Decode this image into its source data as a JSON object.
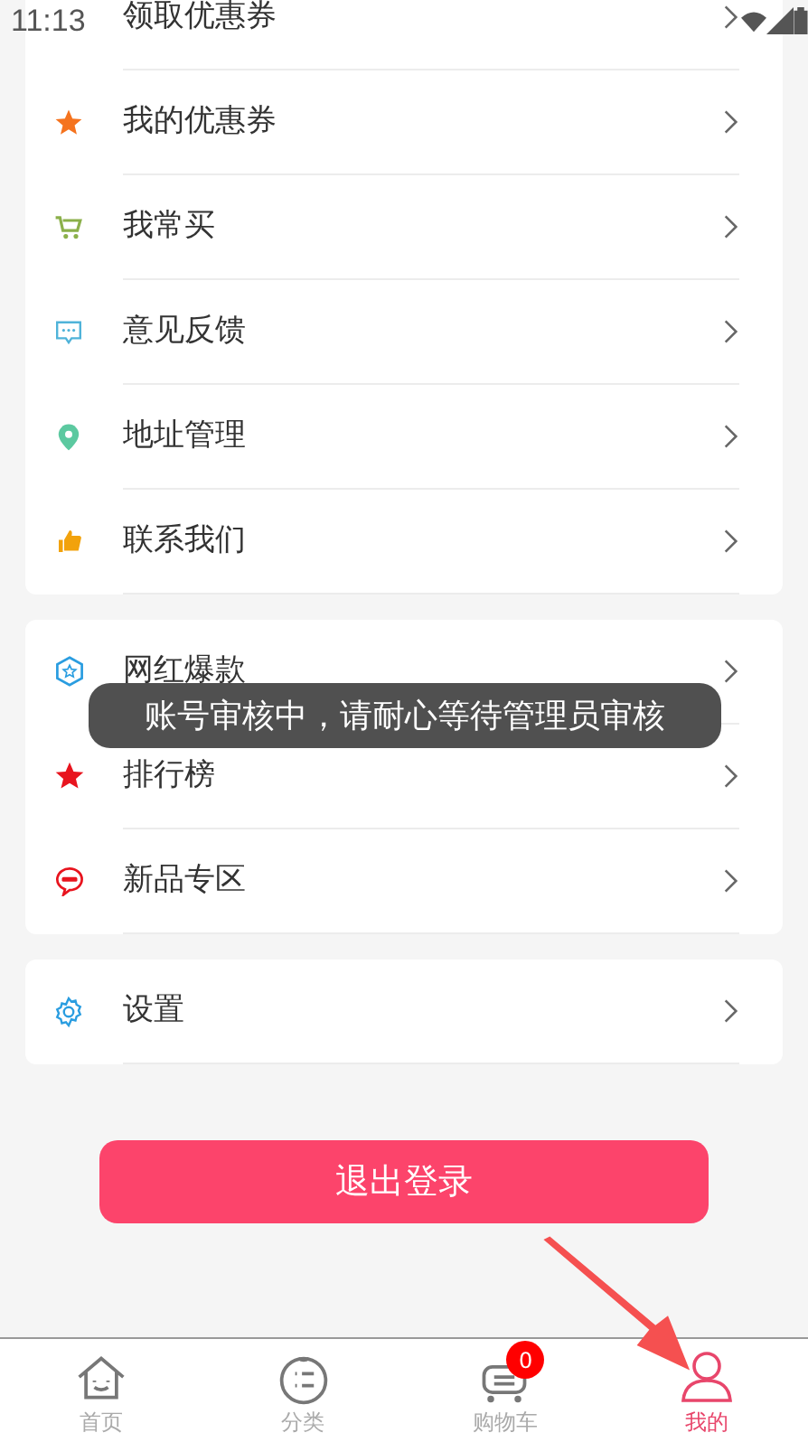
{
  "status_bar": {
    "time": "11:13"
  },
  "menu_groups": [
    {
      "items": [
        {
          "label": "领取优惠券"
        },
        {
          "label": "我的优惠券"
        },
        {
          "label": "我常买"
        },
        {
          "label": "意见反馈"
        },
        {
          "label": "地址管理"
        },
        {
          "label": "联系我们"
        }
      ]
    },
    {
      "items": [
        {
          "label": "网红爆款"
        },
        {
          "label": "排行榜"
        },
        {
          "label": "新品专区"
        }
      ]
    },
    {
      "items": [
        {
          "label": "设置"
        }
      ]
    }
  ],
  "logout_button": "退出登录",
  "toast": "账号审核中，请耐心等待管理员审核",
  "tabs": [
    {
      "label": "首页",
      "selected": false
    },
    {
      "label": "分类",
      "selected": false
    },
    {
      "label": "购物车",
      "selected": false,
      "badge": "0"
    },
    {
      "label": "我的",
      "selected": true
    }
  ]
}
